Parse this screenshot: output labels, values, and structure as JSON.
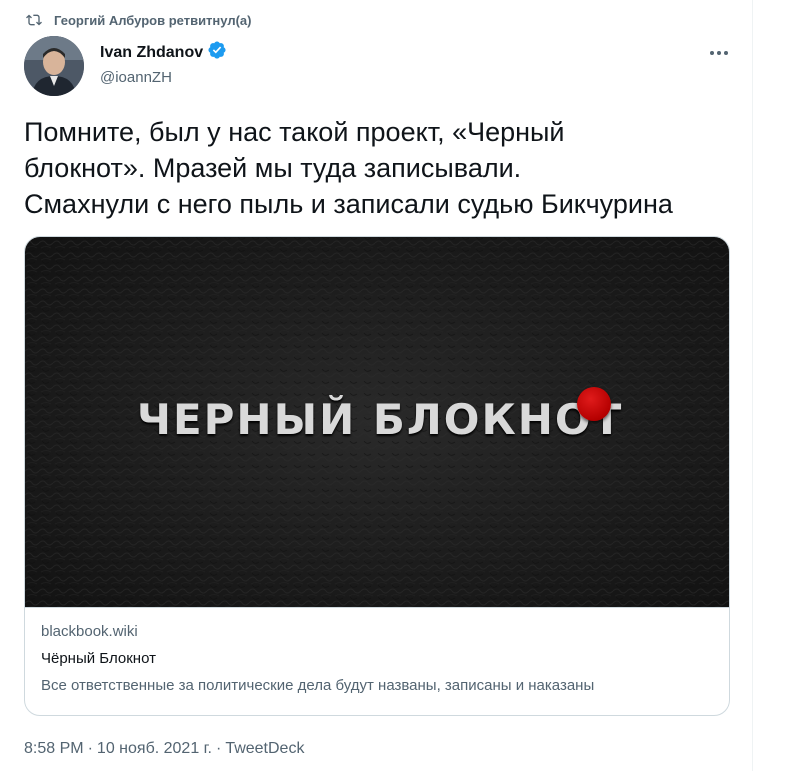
{
  "retweet": {
    "icon": "retweet-icon",
    "text": "Георгий Албуров ретвитнул(а)"
  },
  "author": {
    "name": "Ivan Zhdanov",
    "handle": "@ioannZH",
    "verified_icon": "verified-badge-icon",
    "verified_color": "#1d9bf0"
  },
  "more_icon": "more-dots-icon",
  "tweet": {
    "text": "Помните, был у нас такой проект, «Черный\nблокнот». Мразей мы туда записывали.\nСмахнули с него пыль и записали судью Бикчурина"
  },
  "card": {
    "image_brand_text": "ЧЕРНЫЙ БЛОКНОТ",
    "brand_dot_color": "#c40000",
    "domain": "blackbook.wiki",
    "title": "Чёрный Блокнот",
    "description": "Все ответственные за политические дела будут названы, записаны и наказаны"
  },
  "meta": {
    "time": "8:58 PM",
    "separator1": "·",
    "date": "10 нояб. 2021 г.",
    "separator2": "·",
    "source": "TweetDeck"
  },
  "colors": {
    "text_primary": "#0f1419",
    "text_secondary": "#536471",
    "border": "#cfd9de"
  }
}
